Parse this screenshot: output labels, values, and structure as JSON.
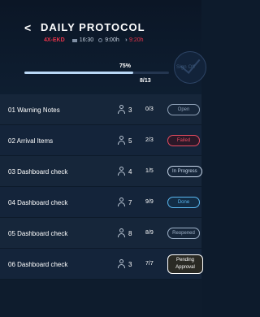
{
  "header": {
    "back_label": "<",
    "title": "DAILY PROTOCOL",
    "code": "4X-EKD",
    "time": "16:30",
    "duration": "9:00h",
    "remaining": "9:20h",
    "percent_label": "75%",
    "progress": 0.75,
    "count_label": "8/13",
    "signoff_label": "Sign Off"
  },
  "items": [
    {
      "label": "01  Warning Notes",
      "users": "3",
      "progress": "0/3",
      "status": "Open"
    },
    {
      "label": "02  Arrival Items",
      "users": "5",
      "progress": "2/3",
      "status": "Failed"
    },
    {
      "label": "03  Dashboard check",
      "users": "4",
      "progress": "1/5",
      "status": "In Progress"
    },
    {
      "label": "04  Dashboard check",
      "users": "7",
      "progress": "9/9",
      "status": "Done"
    },
    {
      "label": "05  Dashboard check",
      "users": "8",
      "progress": "8/9",
      "status": "Reopened"
    },
    {
      "label": "06  Dashboard check",
      "users": "3",
      "progress": "7/7",
      "status": "Pending Approval"
    }
  ],
  "colors": {
    "background": "#0e1c2d",
    "accent_red": "#e8334a",
    "progress_fill": "#b9d8f5"
  },
  "icons": {
    "back": "chevron-left-icon",
    "aircraft": "aircraft-icon",
    "clock": "clock-icon",
    "timer": "timer-icon",
    "user": "user-icon",
    "signoff": "check-icon"
  }
}
